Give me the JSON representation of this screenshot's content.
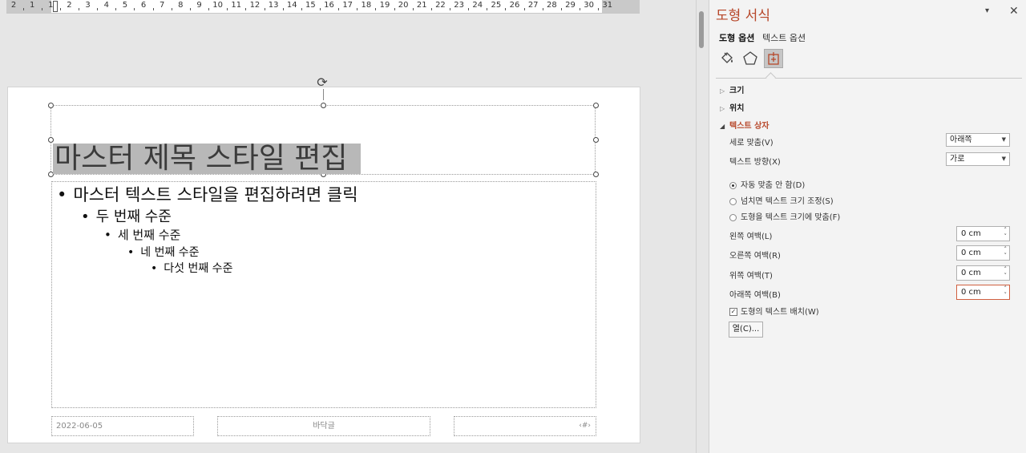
{
  "ruler": {
    "labels": [
      "2",
      "1",
      "1",
      "2",
      "3",
      "4",
      "5",
      "6",
      "7",
      "8",
      "9",
      "10",
      "11",
      "12",
      "13",
      "14",
      "15",
      "16",
      "17",
      "18",
      "19",
      "20",
      "21",
      "22",
      "23",
      "24",
      "25",
      "26",
      "27",
      "28",
      "29",
      "30",
      "31"
    ]
  },
  "slide": {
    "title": "마스터 제목 스타일 편집",
    "bullets": [
      {
        "dot": "•",
        "text": "마스터 텍스트 스타일을 편집하려면 클릭"
      },
      {
        "dot": "•",
        "text": "두 번째 수준"
      },
      {
        "dot": "•",
        "text": "세 번째 수준"
      },
      {
        "dot": "•",
        "text": "네 번째 수준"
      },
      {
        "dot": "•",
        "text": "다섯 번째 수준"
      }
    ],
    "footer_date": "2022-06-05",
    "footer_center": "바닥글",
    "footer_number": "‹#›"
  },
  "pane": {
    "title": "도형 서식",
    "collapse_icon": "▾",
    "close_icon": "✕",
    "tabs": {
      "shape_options": "도형 옵션",
      "text_options": "텍스트 옵션"
    },
    "icons": [
      "fill-line-icon",
      "effects-icon",
      "size-properties-icon"
    ],
    "sections": {
      "size": "크기",
      "position": "위치",
      "textbox": "텍스트 상자"
    },
    "vertical_align": {
      "label": "세로 맞춤(V)",
      "value": "아래쪽"
    },
    "text_direction": {
      "label": "텍스트 방향(X)",
      "value": "가로"
    },
    "autofit": [
      {
        "label": "자동 맞춤 안 함(D)",
        "selected": true
      },
      {
        "label": "넘치면 텍스트 크기 조정(S)",
        "selected": false
      },
      {
        "label": "도형을 텍스트 크기에 맞춤(F)",
        "selected": false
      }
    ],
    "margins": [
      {
        "label": "왼쪽 여백(L)",
        "value": "0 cm"
      },
      {
        "label": "오른쪽 여백(R)",
        "value": "0 cm"
      },
      {
        "label": "위쪽 여백(T)",
        "value": "0 cm"
      },
      {
        "label": "아래쪽 여백(B)",
        "value": "0 cm"
      }
    ],
    "wrap_text": {
      "label": "도형의 텍스트 배치(W)",
      "checked": true
    },
    "columns_button": "열(C)..."
  },
  "colors": {
    "accent": "#b7472a",
    "selection": "#b8b8b8"
  }
}
